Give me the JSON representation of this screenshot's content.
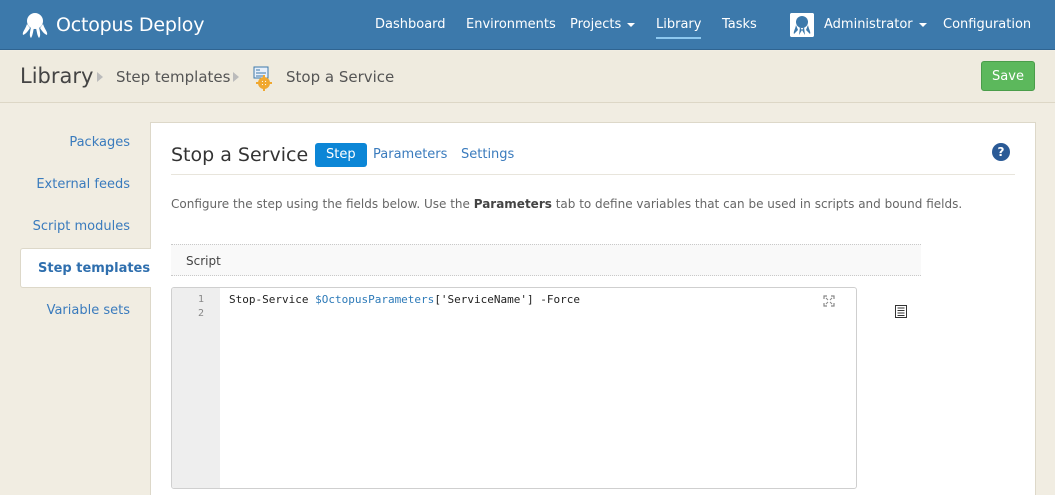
{
  "brand": {
    "name": "Octopus Deploy",
    "logo_icon": "octopus-logo-icon"
  },
  "nav": {
    "dashboard": "Dashboard",
    "environments": "Environments",
    "projects": "Projects",
    "library": "Library",
    "tasks": "Tasks",
    "user": "Administrator",
    "configuration": "Configuration"
  },
  "breadcrumb": {
    "root": "Library",
    "level1": "Step templates",
    "level2": "Stop a Service"
  },
  "toolbar": {
    "save_label": "Save"
  },
  "sidebar": {
    "items": [
      "Packages",
      "External feeds",
      "Script modules",
      "Step templates",
      "Variable sets"
    ],
    "active": "Step templates"
  },
  "panel": {
    "title": "Stop a Service",
    "tabs": {
      "step": "Step",
      "parameters": "Parameters",
      "settings": "Settings"
    },
    "help": "?",
    "desc_before": "Configure the step using the fields below. Use the ",
    "desc_bold": "Parameters",
    "desc_after": " tab to define variables that can be used in scripts and bound fields.",
    "section_label": "Script"
  },
  "editor": {
    "line_numbers": [
      "1",
      "2"
    ],
    "code_cmd": "Stop-Service ",
    "code_var": "$OctopusParameters",
    "code_rest": "['ServiceName'] -Force"
  },
  "colors": {
    "navbar": "#3c79ab",
    "accent": "#0c86d6",
    "save": "#5cb85c",
    "link": "#3a7bbd"
  }
}
